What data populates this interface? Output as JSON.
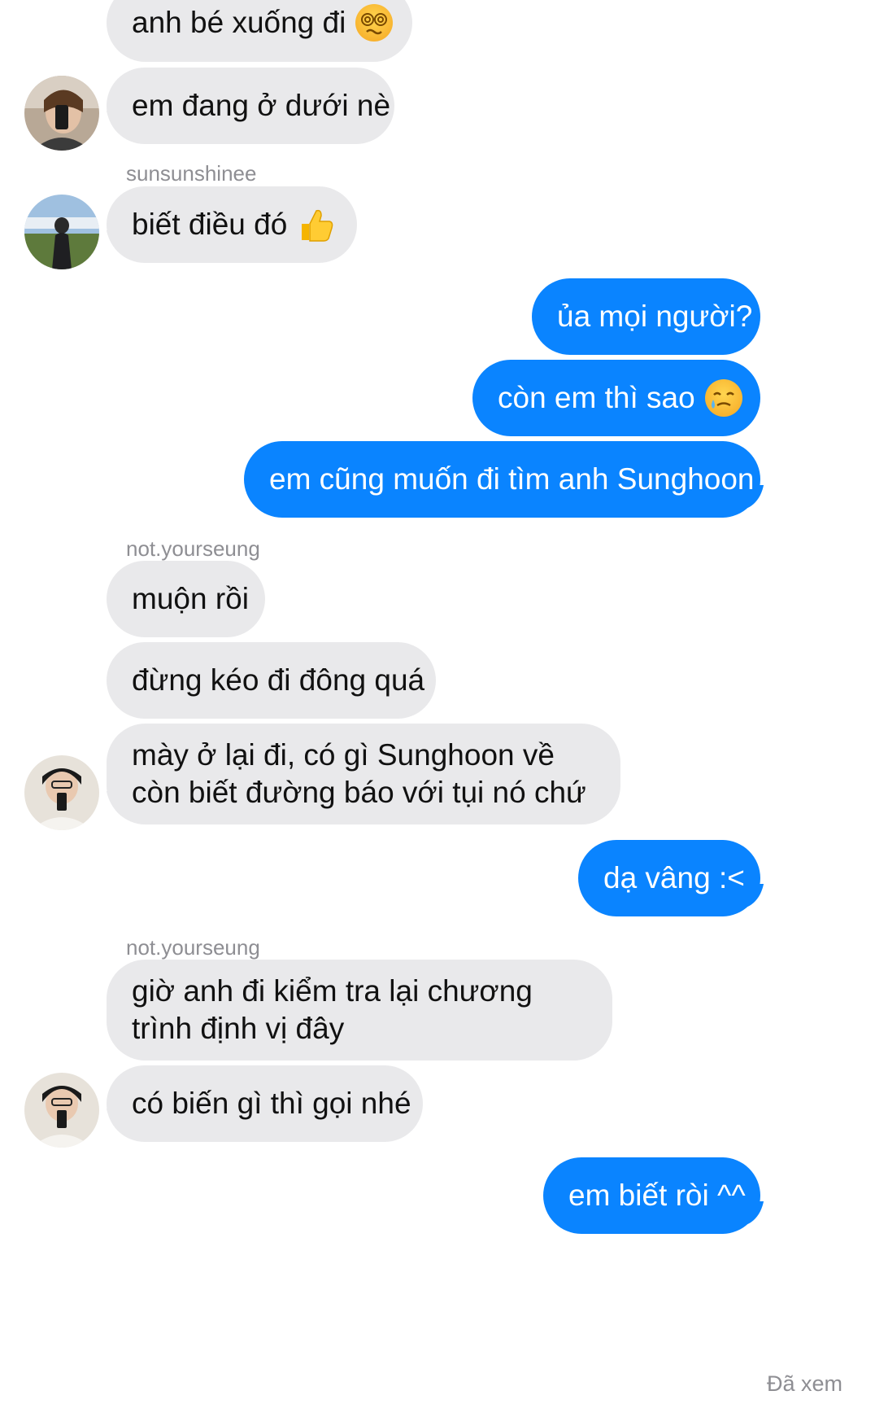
{
  "messages": {
    "m1": "anh bé xuống đi",
    "m2": "em đang ở dưới nè",
    "m3": "biết điều đó",
    "m4": "ủa mọi người?",
    "m5": "còn em thì sao",
    "m6": "em cũng muốn đi tìm anh Sunghoon",
    "m7": "muộn rồi",
    "m8": "đừng kéo đi đông quá",
    "m9": "mày ở lại đi, có gì Sunghoon về còn biết đường báo với tụi nó chứ",
    "m10": "dạ vâng :<",
    "m11": "giờ anh đi kiểm tra lại chương trình định vị đây",
    "m12": "có biến gì thì gọi nhé",
    "m13": "em biết ròi ^^"
  },
  "senders": {
    "s1": "sunsunshinee",
    "s2": "not.yourseung",
    "s3": "not.yourseung"
  },
  "emoji": {
    "dizzy": "dizzy-face-emoji",
    "thumbs": "thumbs-up-emoji",
    "tear": "smiling-face-with-tear-emoji"
  },
  "status": {
    "seen": "Đã xem"
  },
  "colors": {
    "incoming_bubble": "#e9e9eb",
    "outgoing_bubble": "#0a84ff",
    "meta_text": "#8e8e93"
  }
}
